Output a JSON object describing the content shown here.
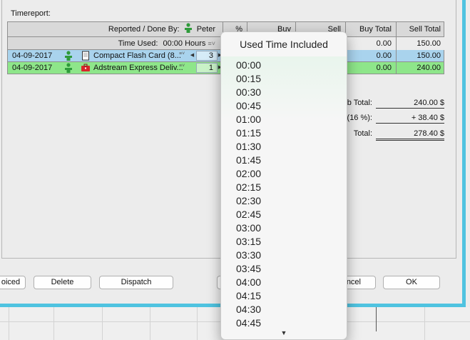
{
  "timereport_label": "Timereport:",
  "header": {
    "reported_label": "Reported / Done By:",
    "reported_user": "Peter",
    "time_used_label": "Time Used:",
    "time_used_value": "00:00 Hours",
    "col_percent": "%",
    "col_buy": "Buy",
    "col_sell": "Sell",
    "col_buy_total": "Buy Total",
    "col_sell_total": "Sell Total",
    "buy_total_value": "0.00",
    "sell_total_value": "150.00"
  },
  "rows": [
    {
      "date": "04-09-2017",
      "description": "Compact Flash Card (8...",
      "qty": "3",
      "buy_total": "0.00",
      "sell_total": "150.00",
      "item_icon": "document-icon"
    },
    {
      "date": "04-09-2017",
      "description": "Adstream Express Deliv...",
      "qty": "1",
      "buy_total": "0.00",
      "sell_total": "240.00",
      "item_icon": "toolbox-icon"
    }
  ],
  "summary": {
    "subtotal_label": "b Total:",
    "subtotal_value": "240.00 $",
    "tax_label": "(16 %):",
    "tax_value": "+ 38.40 $",
    "total_label": "Total:",
    "total_value": "278.40 $"
  },
  "buttons": {
    "invoiced": "oiced",
    "delete": "Delete",
    "dispatch": "Dispatch",
    "cancel": "ncel",
    "ok": "OK"
  },
  "popup": {
    "title": "Used Time Included",
    "options": [
      "00:00",
      "00:15",
      "00:30",
      "00:45",
      "01:00",
      "01:15",
      "01:30",
      "01:45",
      "02:00",
      "02:15",
      "02:30",
      "02:45",
      "03:00",
      "03:15",
      "03:30",
      "03:45",
      "04:00",
      "04:15",
      "04:30",
      "04:45"
    ],
    "scroll_indicator": "▼"
  },
  "colors": {
    "frame_accent": "#4fc3e0",
    "row_blue": "#a9d3ed",
    "row_green": "#8ee68a",
    "person_green": "#2e9a3a"
  }
}
